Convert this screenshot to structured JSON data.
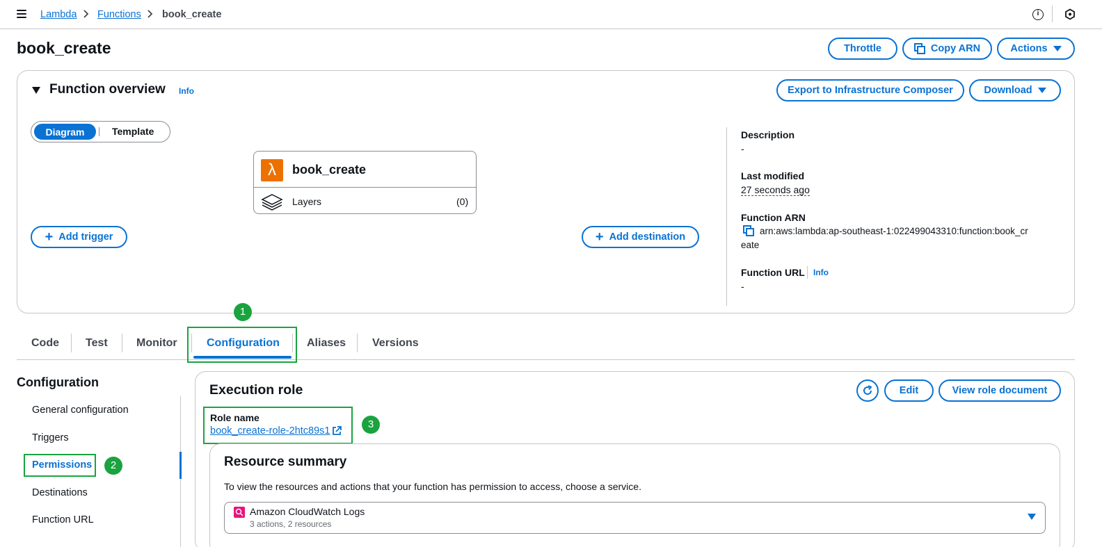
{
  "breadcrumb": [
    "Lambda",
    "Functions",
    "book_create"
  ],
  "header": {
    "title": "book_create",
    "buttons": {
      "throttle": "Throttle",
      "copy_arn": "Copy ARN",
      "actions": "Actions"
    }
  },
  "overview": {
    "title": "Function overview",
    "info": "Info",
    "export_button": "Export to Infrastructure Composer",
    "download_button": "Download",
    "view_toggle": {
      "selected": "Diagram",
      "other": "Template"
    },
    "function_name": "book_create",
    "layers_label": "Layers",
    "layers_count": "(0)",
    "add_trigger": "Add trigger",
    "add_destination": "Add destination",
    "details": {
      "description_label": "Description",
      "description_value": "-",
      "last_modified_label": "Last modified",
      "last_modified_value": "27 seconds ago",
      "arn_label": "Function ARN",
      "arn_value_line1": "arn:aws:lambda:ap-southeast-1:022499043310:function:book_cr",
      "arn_value_line2": "eate",
      "url_label": "Function URL",
      "url_info": "Info",
      "url_value": "-"
    }
  },
  "tabs": [
    "Code",
    "Test",
    "Monitor",
    "Configuration",
    "Aliases",
    "Versions"
  ],
  "active_tab": "Configuration",
  "annotations": [
    "1",
    "2",
    "3"
  ],
  "sidebar": {
    "title": "Configuration",
    "items": [
      "General configuration",
      "Triggers",
      "Permissions",
      "Destinations",
      "Function URL"
    ],
    "active": "Permissions"
  },
  "execution_role": {
    "title": "Execution role",
    "edit_button": "Edit",
    "view_button": "View role document",
    "role_name_label": "Role name",
    "role_name_value": "book_create-role-2htc89s1"
  },
  "resource_summary": {
    "title": "Resource summary",
    "description": "To view the resources and actions that your function has permission to access, choose a service.",
    "selected_service": "Amazon CloudWatch Logs",
    "selected_service_meta": "3 actions, 2 resources"
  },
  "colors": {
    "accent": "#0972d3",
    "annotation": "#1aa33f",
    "lambda_orange": "#ed7100",
    "cloudwatch_pink": "#e7157b"
  }
}
